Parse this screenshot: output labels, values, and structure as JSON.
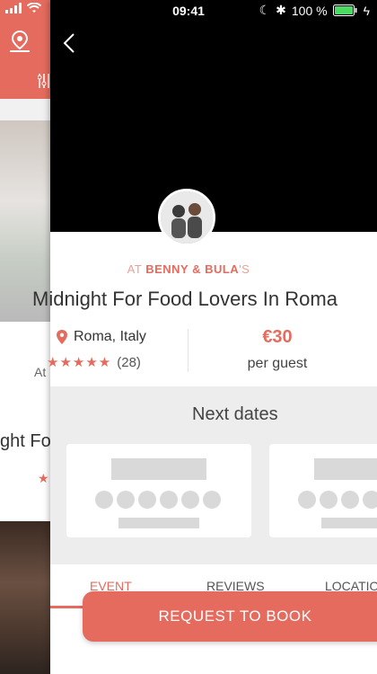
{
  "status_bar": {
    "time": "09:41",
    "battery": "100 %"
  },
  "background_screen": {
    "at_label": "At",
    "title_fragment": "ght Fo"
  },
  "listing": {
    "host_prefix": "AT",
    "host_name": "BENNY & BULA",
    "host_suffix": "'S",
    "title": "Midnight For Food Lovers In Roma",
    "location": "Roma, Italy",
    "stars": "★★★★★",
    "review_count": "(28)",
    "rating": 5,
    "price": "€30",
    "price_unit": "per guest"
  },
  "next_dates": {
    "heading": "Next dates"
  },
  "tabs": [
    {
      "label": "EVENT",
      "active": true
    },
    {
      "label": "REVIEWS",
      "active": false
    },
    {
      "label": "LOCATION",
      "active": false
    }
  ],
  "cta": {
    "label": "REQUEST TO BOOK"
  },
  "colors": {
    "accent": "#e56b5e",
    "hero": "#000000",
    "panel": "#ededed"
  }
}
